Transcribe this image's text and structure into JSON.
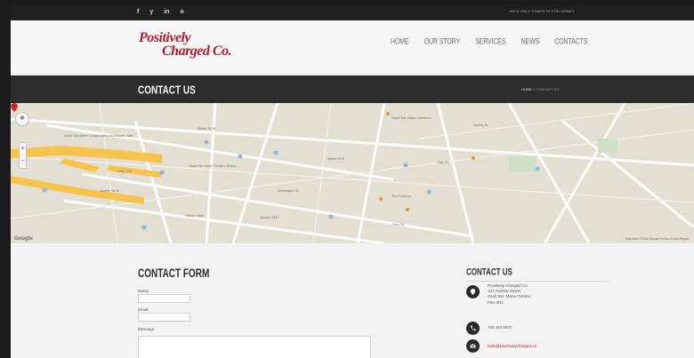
{
  "topbar": {
    "social": [
      "f",
      "y",
      "in",
      "o"
    ],
    "tagline": "WE'D ONLY COMPETE FOR MONEY"
  },
  "logo": {
    "line1": "Positively",
    "line2": "Charged Co."
  },
  "nav": [
    "HOME",
    "OUR STORY",
    "SERVICES",
    "NEWS",
    "CONTACTS"
  ],
  "page": {
    "title": "CONTACT US",
    "breadcrumb_home": "HOME",
    "breadcrumb_sep": "»",
    "breadcrumb_current": "CONTACT US"
  },
  "map": {
    "google": "Google",
    "footer": "Map data ©2016 Google  Terms of Use  Report",
    "streets": [
      "Sault Ste Marie Canal National Historic Site",
      "Queen St W",
      "Queen St E",
      "Albert St W",
      "Albert St E",
      "Wellington St",
      "Spring St",
      "Pim St",
      "Hwy 17B"
    ],
    "places": [
      "Sault Ste Marie Public Library",
      "Sault Ste. Marie Museum",
      "Station Mall",
      "Tim Hortons",
      "Bay St"
    ]
  },
  "form": {
    "title": "CONTACT FORM",
    "name_label": "Name:",
    "email_label": "Email:",
    "message_label": "Message:"
  },
  "contact": {
    "title": "CONTACT US",
    "address": [
      "Positively Charged Co.",
      "137 Andrew Street",
      "Sault Ste. Marie Ontario",
      "P6A 3R2"
    ],
    "phone": "705 453 5870",
    "email": "hello@positivelycharged.ca"
  }
}
